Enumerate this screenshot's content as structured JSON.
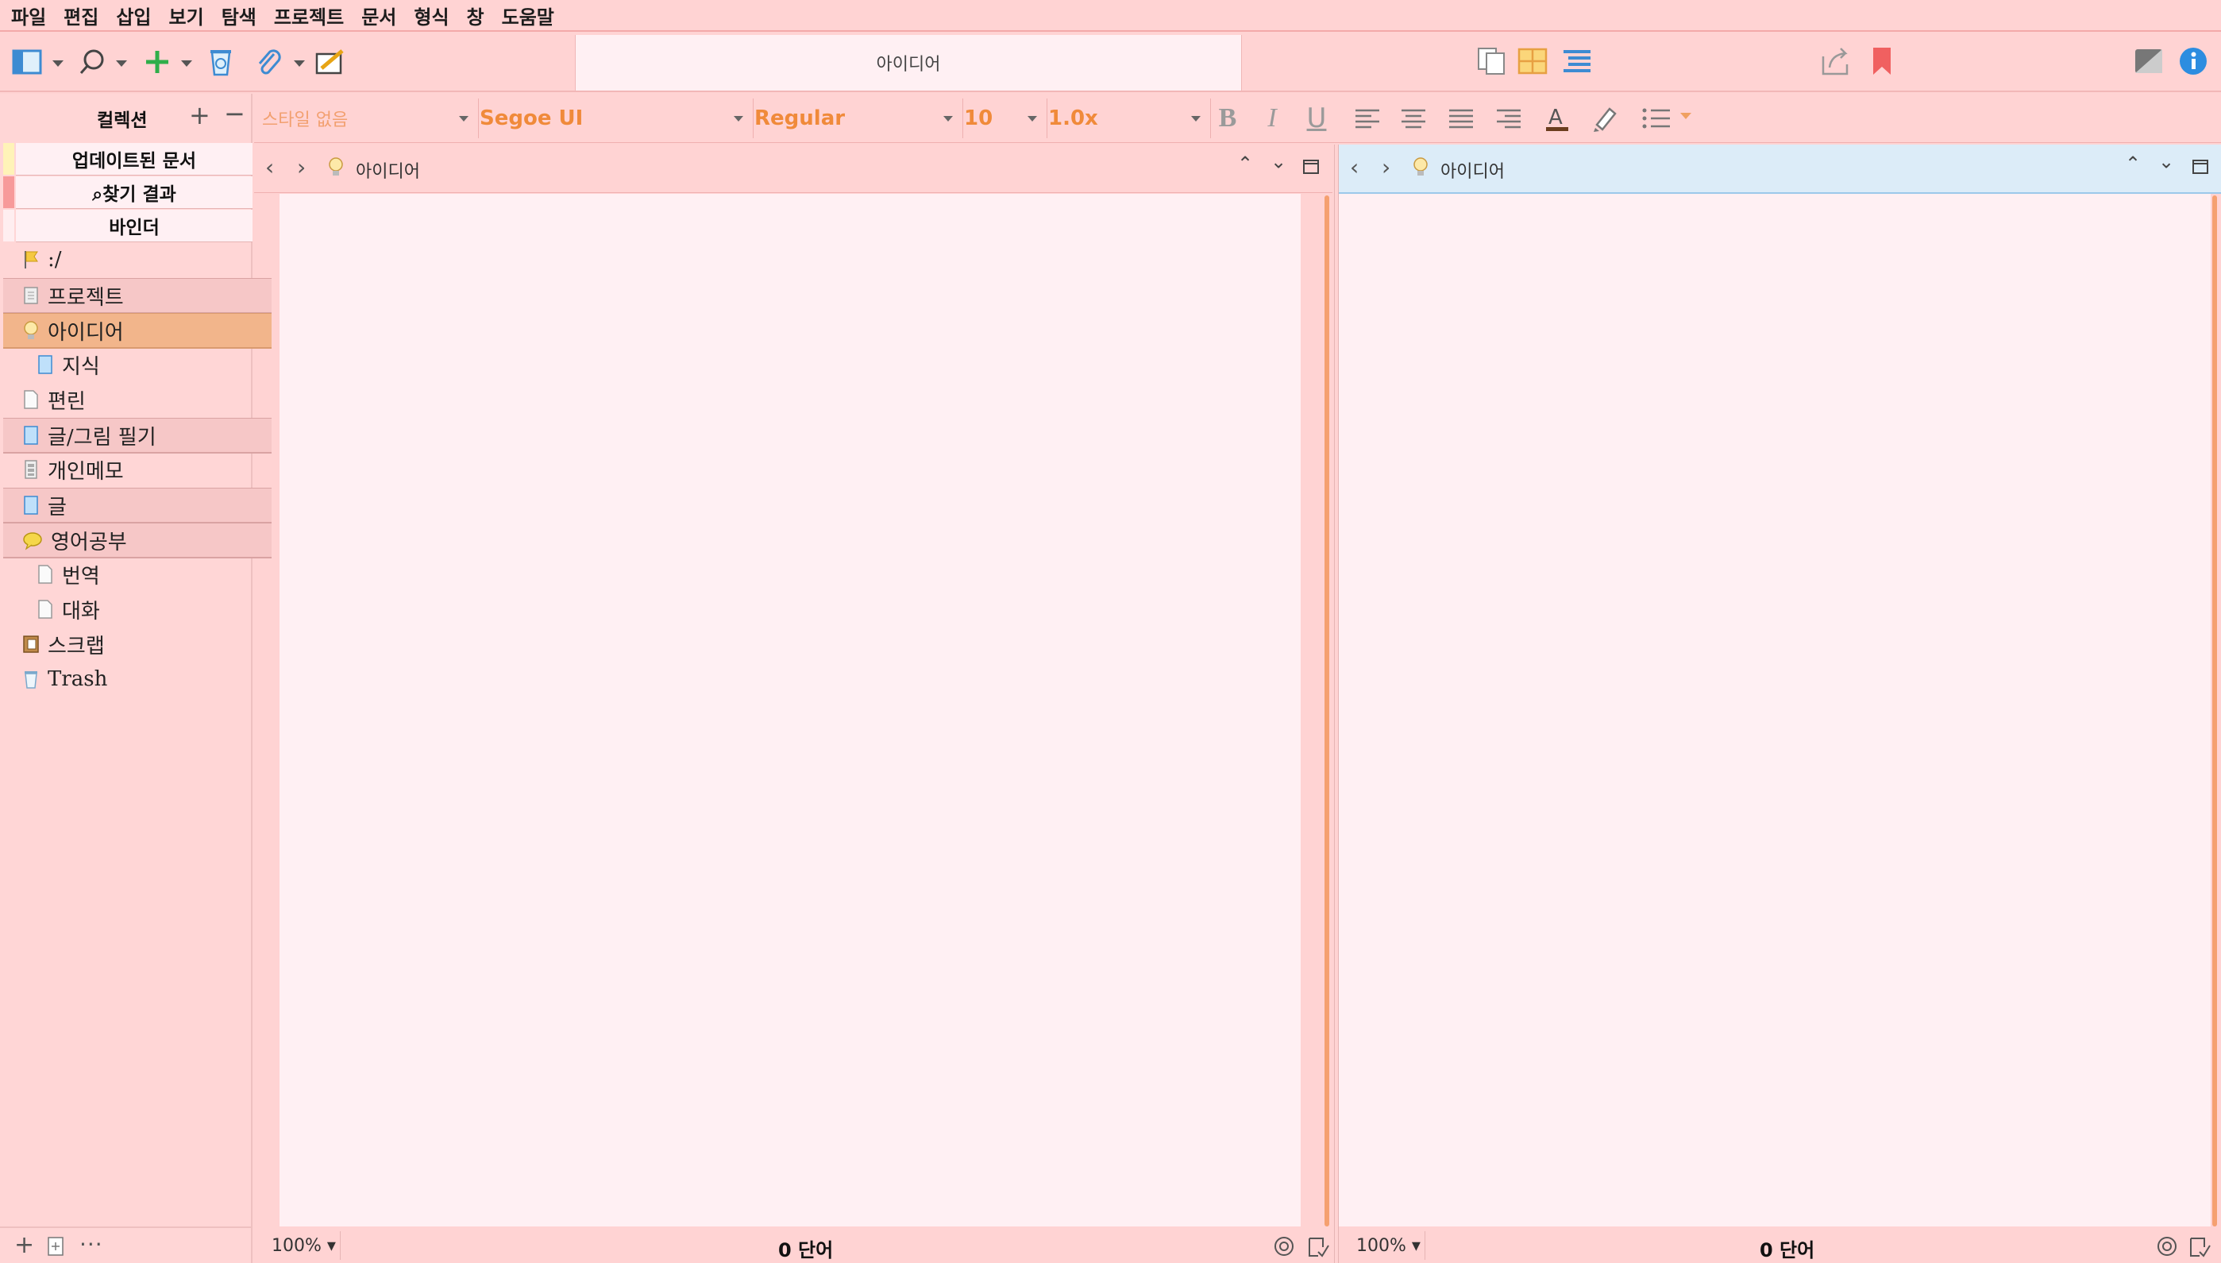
{
  "menu": [
    "파일",
    "편집",
    "삽입",
    "보기",
    "탐색",
    "프로젝트",
    "문서",
    "형식",
    "창",
    "도움말"
  ],
  "toolbar": {
    "title": "아이디어"
  },
  "format": {
    "style": "스타일 없음",
    "font": "Segoe UI",
    "weight": "Regular",
    "size": "10",
    "line_spacing": "1.0x"
  },
  "sidebar": {
    "header": "컬렉션",
    "tabs": [
      "업데이트된 문서",
      "⌕찾기 결과",
      "바인더"
    ],
    "items": [
      {
        "label": ":/",
        "icon": "flag-icon"
      },
      {
        "label": "프로젝트",
        "icon": "folder-doc-icon"
      },
      {
        "label": "아이디어",
        "icon": "lightbulb-icon"
      },
      {
        "label": "지식",
        "icon": "blue-doc-icon"
      },
      {
        "label": "편린",
        "icon": "page-icon"
      },
      {
        "label": "글/그림 필기",
        "icon": "blue-doc-icon"
      },
      {
        "label": "개인메모",
        "icon": "stack-doc-icon"
      },
      {
        "label": "글",
        "icon": "blue-doc-icon"
      },
      {
        "label": "영어공부",
        "icon": "speech-bubble-icon"
      },
      {
        "label": "번역",
        "icon": "page-icon"
      },
      {
        "label": "대화",
        "icon": "page-icon"
      },
      {
        "label": "스크랩",
        "icon": "scrapbook-icon"
      },
      {
        "label": "Trash",
        "icon": "trash-icon"
      }
    ]
  },
  "left_pane": {
    "title": "아이디어",
    "zoom": "100%",
    "word_count": "0 단어"
  },
  "right_pane": {
    "title": "아이디어",
    "zoom": "100%",
    "word_count": "0 단어"
  },
  "colors": {
    "accent": "#f08a3a",
    "selected_row": "#f2b58b",
    "background": "#ffd3d3",
    "paper": "#fff0f3",
    "right_header": "#dcecf8"
  }
}
